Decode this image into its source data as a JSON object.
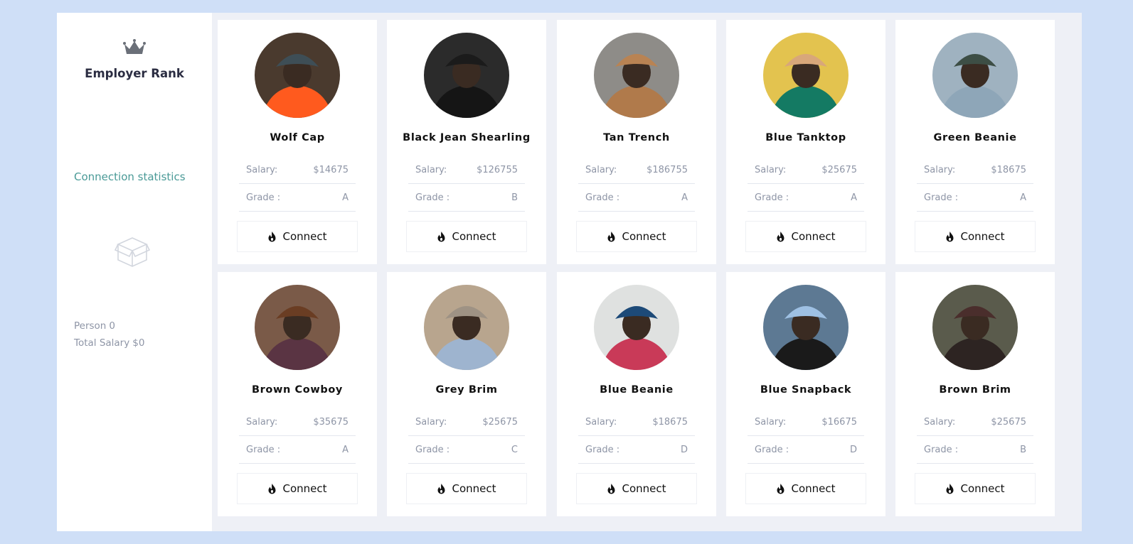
{
  "brand": {
    "title": "Employer Rank",
    "icon": "crown-icon"
  },
  "sidebar": {
    "stats_link": "Connection statistics",
    "empty_icon": "box-icon",
    "person_label": "Person",
    "person_value": "0",
    "total_label": "Total Salary",
    "total_value": "$0"
  },
  "labels": {
    "salary": "Salary:",
    "grade": "Grade :",
    "connect": "Connect"
  },
  "cards": [
    {
      "name": "Wolf Cap",
      "salary": "$14675",
      "grade": "A",
      "bg": "#4a3a2e",
      "hat": "#3e4e56",
      "body": "#ff5a1e"
    },
    {
      "name": "Black Jean Shearling",
      "salary": "$126755",
      "grade": "B",
      "bg": "#2b2b2b",
      "hat": "#1b1b1b",
      "body": "#151515"
    },
    {
      "name": "Tan Trench",
      "salary": "$186755",
      "grade": "A",
      "bg": "#8e8c88",
      "hat": "#b98353",
      "body": "#b07a4b"
    },
    {
      "name": "Blue Tanktop",
      "salary": "$25675",
      "grade": "A",
      "bg": "#e3c34f",
      "hat": "#d8a77a",
      "body": "#147a63"
    },
    {
      "name": "Green Beanie",
      "salary": "$18675",
      "grade": "A",
      "bg": "#9fb2c0",
      "hat": "#3d4e45",
      "body": "#8ea6b8"
    },
    {
      "name": "Brown Cowboy",
      "salary": "$35675",
      "grade": "A",
      "bg": "#7a5a48",
      "hat": "#6a3d23",
      "body": "#5a3443"
    },
    {
      "name": "Grey Brim",
      "salary": "$25675",
      "grade": "C",
      "bg": "#b8a58e",
      "hat": "#9e9284",
      "body": "#9eb4cf"
    },
    {
      "name": "Blue Beanie",
      "salary": "$18675",
      "grade": "D",
      "bg": "#dfe1e0",
      "hat": "#1d4a78",
      "body": "#c93a58"
    },
    {
      "name": "Blue Snapback",
      "salary": "$16675",
      "grade": "D",
      "bg": "#5d7993",
      "hat": "#9ec0e3",
      "body": "#1a1a1a"
    },
    {
      "name": "Brown Brim",
      "salary": "$25675",
      "grade": "B",
      "bg": "#5a5b4c",
      "hat": "#4a2e2c",
      "body": "#2d2422"
    }
  ],
  "colors": {
    "page_bg": "#cfdff7",
    "accent": "#4a9a97",
    "muted": "#8e95a6"
  }
}
